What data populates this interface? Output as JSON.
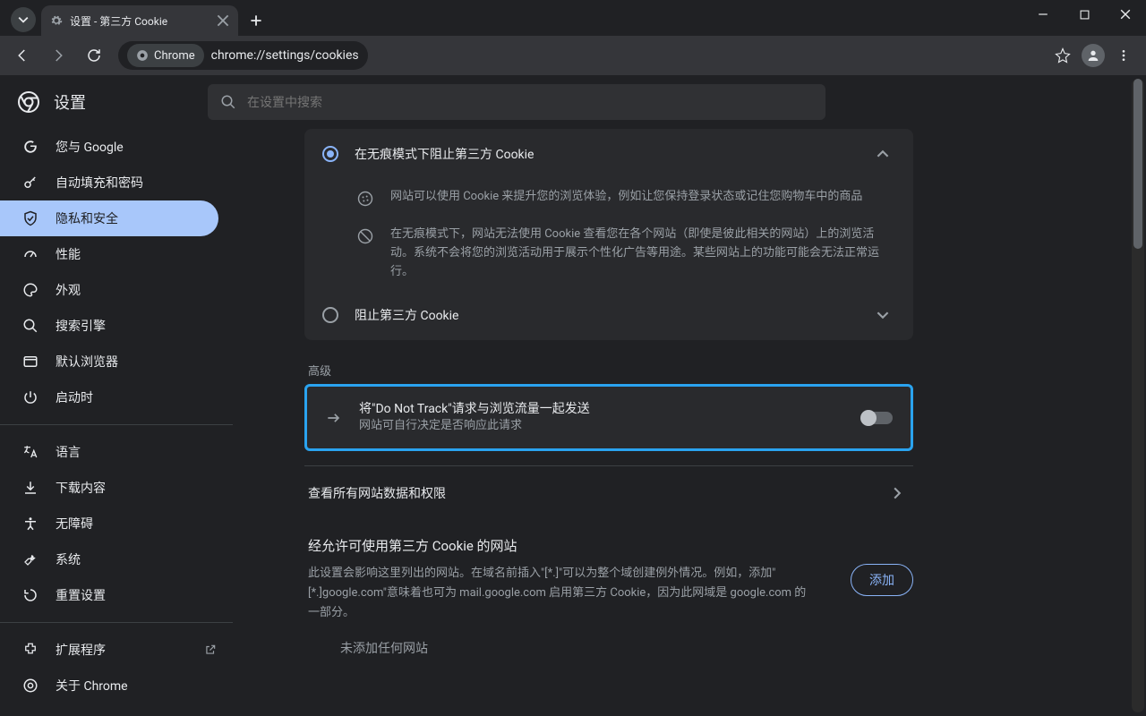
{
  "window": {
    "tab_title": "设置 - 第三方 Cookie",
    "url": "chrome://settings/cookies",
    "omnibox_chip": "Chrome"
  },
  "app": {
    "title": "设置",
    "search_placeholder": "在设置中搜索"
  },
  "sidebar": {
    "items": [
      {
        "label": "您与 Google"
      },
      {
        "label": "自动填充和密码"
      },
      {
        "label": "隐私和安全"
      },
      {
        "label": "性能"
      },
      {
        "label": "外观"
      },
      {
        "label": "搜索引擎"
      },
      {
        "label": "默认浏览器"
      },
      {
        "label": "启动时"
      }
    ],
    "more": [
      {
        "label": "语言"
      },
      {
        "label": "下载内容"
      },
      {
        "label": "无障碍"
      },
      {
        "label": "系统"
      },
      {
        "label": "重置设置"
      }
    ],
    "footer": [
      {
        "label": "扩展程序"
      },
      {
        "label": "关于 Chrome"
      }
    ]
  },
  "cookies": {
    "option_incognito": "在无痕模式下阻止第三方 Cookie",
    "desc_cookie_use": "网站可以使用 Cookie 来提升您的浏览体验，例如让您保持登录状态或记住您购物车中的商品",
    "desc_incognito": "在无痕模式下，网站无法使用 Cookie 查看您在各个网站（即使是彼此相关的网站）上的浏览活动。系统不会将您的浏览活动用于展示个性化广告等用途。某些网站上的功能可能会无法正常运行。",
    "option_block_all": "阻止第三方 Cookie",
    "advanced_label": "高级",
    "dnt_title": "将\"Do Not Track\"请求与浏览流量一起发送",
    "dnt_sub": "网站可自行决定是否响应此请求",
    "view_all_data": "查看所有网站数据和权限",
    "allow_section_title": "经允许可使用第三方 Cookie 的网站",
    "allow_section_desc": "此设置会影响这里列出的网站。在域名前插入\"[*.]\"可以为整个域创建例外情况。例如，添加\"[*.]google.com\"意味着也可为 mail.google.com 启用第三方 Cookie，因为此网域是 google.com 的一部分。",
    "add_button": "添加",
    "empty_list": "未添加任何网站"
  }
}
